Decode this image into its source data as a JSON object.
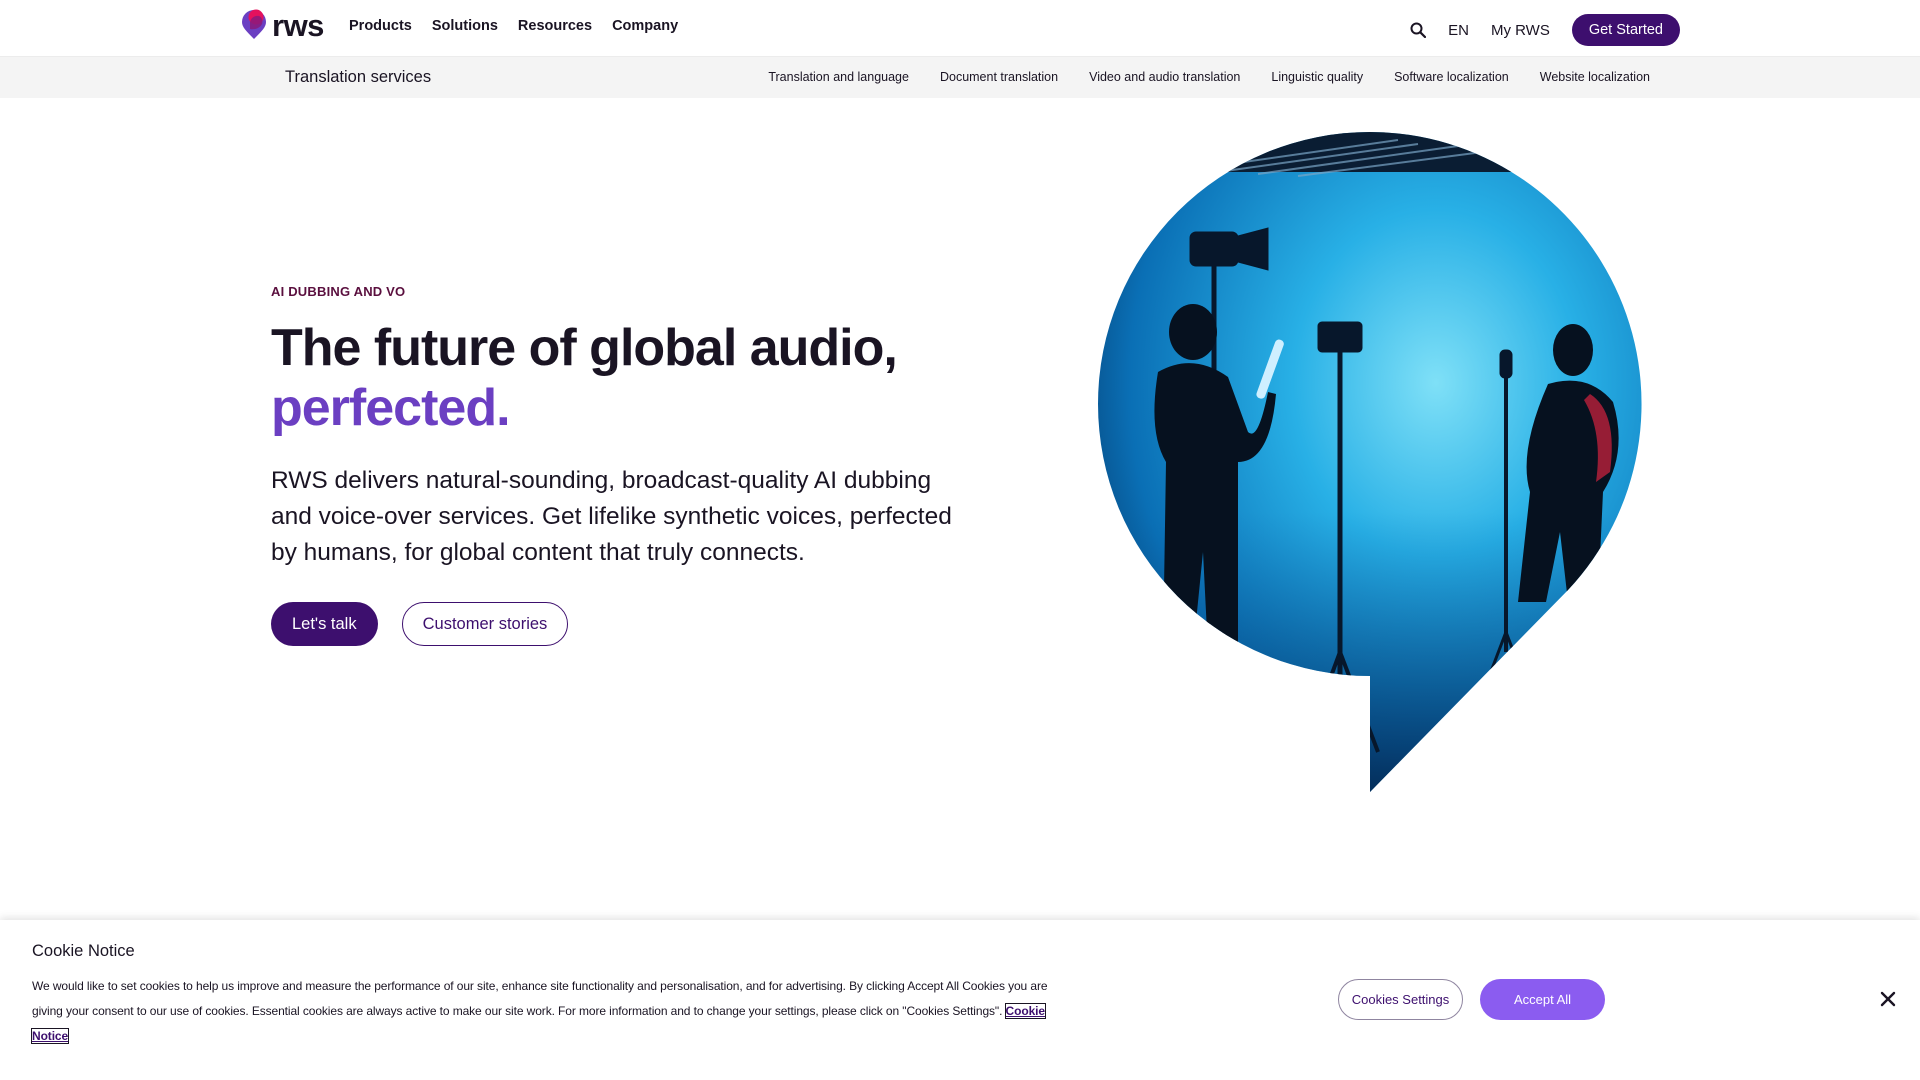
{
  "brand": {
    "logo_text": "rws",
    "primary_color": "#3d0f6e",
    "accent_color": "#6b3fc2"
  },
  "topnav": {
    "menu": [
      "Products",
      "Solutions",
      "Resources",
      "Company"
    ],
    "language": "EN",
    "account": "My RWS",
    "cta": "Get Started",
    "search_icon": "search-icon"
  },
  "subnav": {
    "title": "Translation services",
    "links": [
      "Translation and language",
      "Document translation",
      "Video and audio translation",
      "Linguistic quality",
      "Software localization",
      "Website localization"
    ]
  },
  "hero": {
    "eyebrow": "AI DUBBING AND VO",
    "title_line1": "The future of global audio,",
    "title_line2": "perfected.",
    "body": "RWS delivers natural-sounding, broadcast-quality AI dubbing and voice-over services. Get lifelike synthetic voices, perfected by humans, for global content that truly connects.",
    "primary_button": "Let's talk",
    "secondary_button": "Customer stories"
  },
  "cookie": {
    "title": "Cookie Notice",
    "text": "We would like to set cookies to help us improve and measure the performance of our site, enhance site functionality and personalisation, and for advertising. By clicking Accept All Cookies you are giving your consent to our use of cookies. Essential cookies are always active to make our site work. For more information and to change your settings, please click on \"Cookies Settings\".",
    "link": "Cookie Notice",
    "settings_button": "Cookies Settings",
    "accept_button": "Accept All",
    "close_icon": "close-icon"
  }
}
